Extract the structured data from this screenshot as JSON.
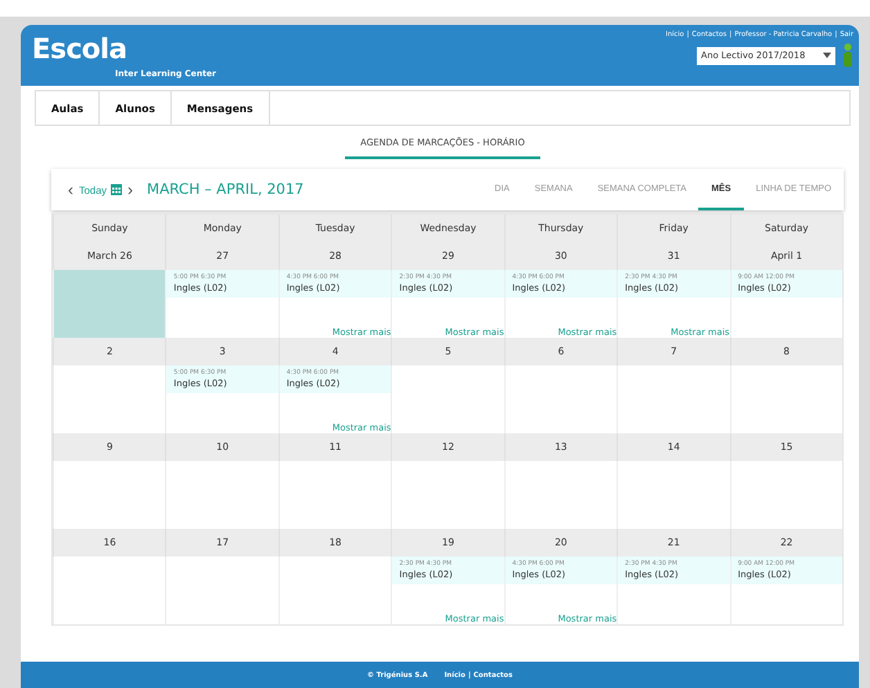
{
  "header": {
    "logo": "Escola",
    "subtitle": "Inter Learning Center",
    "links": [
      "Início",
      "Contactos",
      "Professor - Patricia Carvalho",
      "Sair"
    ],
    "separator": "|",
    "year_select": "Ano Lectivo 2017/2018"
  },
  "nav": [
    {
      "label": "Aulas"
    },
    {
      "label": "Alunos"
    },
    {
      "label": "Mensagens"
    }
  ],
  "page_title": "AGENDA DE MARCAÇÕES - HORÁRIO",
  "toolbar": {
    "prev": "‹",
    "today": "Today",
    "next": "›",
    "range": "MARCH – APRIL, 2017",
    "views": [
      {
        "label": "DIA",
        "selected": false
      },
      {
        "label": "SEMANA",
        "selected": false
      },
      {
        "label": "SEMANA COMPLETA",
        "selected": false
      },
      {
        "label": "MÊS",
        "selected": true
      },
      {
        "label": "LINHA DE TEMPO",
        "selected": false
      }
    ]
  },
  "calendar": {
    "weekdays": [
      "Sunday",
      "Monday",
      "Tuesday",
      "Wednesday",
      "Thursday",
      "Friday",
      "Saturday"
    ],
    "weeks": [
      {
        "days": [
          {
            "date": "March 26",
            "selected": true
          },
          {
            "date": "27",
            "selected": false,
            "events": [
              {
                "time": "5:00 PM 6:30 PM",
                "title": "Ingles (L02)"
              }
            ]
          },
          {
            "date": "28",
            "selected": false,
            "events": [
              {
                "time": "4:30 PM 6:00 PM",
                "title": "Ingles (L02)"
              }
            ],
            "more": "Mostrar mais"
          },
          {
            "date": "29",
            "selected": false,
            "events": [
              {
                "time": "2:30 PM 4:30 PM",
                "title": "Ingles (L02)"
              }
            ],
            "more": "Mostrar mais"
          },
          {
            "date": "30",
            "selected": false,
            "events": [
              {
                "time": "4:30 PM 6:00 PM",
                "title": "Ingles (L02)"
              }
            ],
            "more": "Mostrar mais"
          },
          {
            "date": "31",
            "selected": false,
            "events": [
              {
                "time": "2:30 PM 4:30 PM",
                "title": "Ingles (L02)"
              }
            ],
            "more": "Mostrar mais"
          },
          {
            "date": "April 1",
            "selected": false,
            "events": [
              {
                "time": "9:00 AM 12:00 PM",
                "title": "Ingles (L02)"
              }
            ]
          }
        ]
      },
      {
        "days": [
          {
            "date": "2",
            "selected": false
          },
          {
            "date": "3",
            "selected": false,
            "events": [
              {
                "time": "5:00 PM 6:30 PM",
                "title": "Ingles (L02)"
              }
            ]
          },
          {
            "date": "4",
            "selected": false,
            "events": [
              {
                "time": "4:30 PM 6:00 PM",
                "title": "Ingles (L02)"
              }
            ],
            "more": "Mostrar mais"
          },
          {
            "date": "5",
            "selected": false
          },
          {
            "date": "6",
            "selected": false
          },
          {
            "date": "7",
            "selected": false
          },
          {
            "date": "8",
            "selected": false
          }
        ]
      },
      {
        "days": [
          {
            "date": "9",
            "selected": false
          },
          {
            "date": "10",
            "selected": false
          },
          {
            "date": "11",
            "selected": false
          },
          {
            "date": "12",
            "selected": false
          },
          {
            "date": "13",
            "selected": false
          },
          {
            "date": "14",
            "selected": false
          },
          {
            "date": "15",
            "selected": false
          }
        ]
      },
      {
        "days": [
          {
            "date": "16",
            "selected": false
          },
          {
            "date": "17",
            "selected": false
          },
          {
            "date": "18",
            "selected": false
          },
          {
            "date": "19",
            "selected": false,
            "events": [
              {
                "time": "2:30 PM 4:30 PM",
                "title": "Ingles (L02)"
              }
            ],
            "more": "Mostrar mais"
          },
          {
            "date": "20",
            "selected": false,
            "events": [
              {
                "time": "4:30 PM 6:00 PM",
                "title": "Ingles (L02)"
              }
            ],
            "more": "Mostrar mais"
          },
          {
            "date": "21",
            "selected": false,
            "events": [
              {
                "time": "2:30 PM 4:30 PM",
                "title": "Ingles (L02)"
              }
            ]
          },
          {
            "date": "22",
            "selected": false,
            "events": [
              {
                "time": "9:00 AM 12:00 PM",
                "title": "Ingles (L02)"
              }
            ]
          }
        ]
      }
    ]
  },
  "footer": {
    "copyright": "© Trigénius S.A",
    "links": [
      "Início",
      "Contactos"
    ],
    "separator": "|"
  }
}
